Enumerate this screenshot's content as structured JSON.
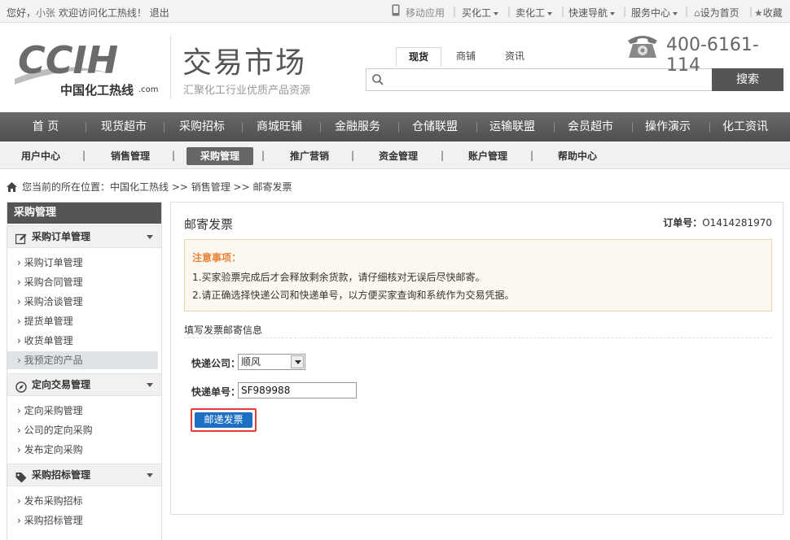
{
  "topbar": {
    "greeting_prefix": "您好，",
    "username": "小张",
    "welcome": "欢迎访问化工热线！",
    "logout": "退出",
    "mobile": "移动应用",
    "buy": "买化工",
    "sell": "卖化工",
    "quicknav": "快速导航",
    "service": "服务中心",
    "homepage": "设为首页",
    "favorite": "收藏"
  },
  "header": {
    "logo_text": "CCIH",
    "logo_cn": "中国化工热线",
    "logo_com": ".com",
    "market_title": "交易市场",
    "market_sub": "汇聚化工行业优质产品资源",
    "search_tabs": [
      "现货",
      "商铺",
      "资讯"
    ],
    "search_placeholder": "",
    "search_button": "搜索",
    "hotline": "400-6161-114"
  },
  "mainnav": [
    "首 页",
    "现货超市",
    "采购招标",
    "商城旺铺",
    "金融服务",
    "仓储联盟",
    "运输联盟",
    "会员超市",
    "操作演示",
    "化工资讯"
  ],
  "subnav": [
    "用户中心",
    "销售管理",
    "采购管理",
    "推广营销",
    "资金管理",
    "账户管理",
    "帮助中心"
  ],
  "breadcrumb": "您当前的所在位置：中国化工热线 >> 销售管理 >> 邮寄发票",
  "sidebar": {
    "title": "采购管理",
    "groups": [
      {
        "name": "采购订单管理",
        "items": [
          "采购订单管理",
          "采购合同管理",
          "采购洽谈管理",
          "提货单管理",
          "收货单管理",
          "我预定的产品"
        ]
      },
      {
        "name": "定向交易管理",
        "items": [
          "定向采购管理",
          "公司的定向采购",
          "发布定向采购"
        ]
      },
      {
        "name": "采购招标管理",
        "items": [
          "发布采购招标",
          "采购招标管理"
        ]
      }
    ]
  },
  "content": {
    "title": "邮寄发票",
    "order_label": "订单号：",
    "order_no": "O1414281970",
    "notice_title": "注意事项：",
    "notice_1": "1.买家验票完成后才会释放剩余货款，请仔细核对无误后尽快邮寄。",
    "notice_2": "2.请正确选择快递公司和快递单号，以方便买家查询和系统作为交易凭据。",
    "fill_title": "填写发票邮寄信息",
    "courier_label": "快递公司：",
    "courier_value": "顺风",
    "tracking_label": "快递单号：",
    "tracking_value": "SF989988",
    "submit": "邮递发票"
  }
}
